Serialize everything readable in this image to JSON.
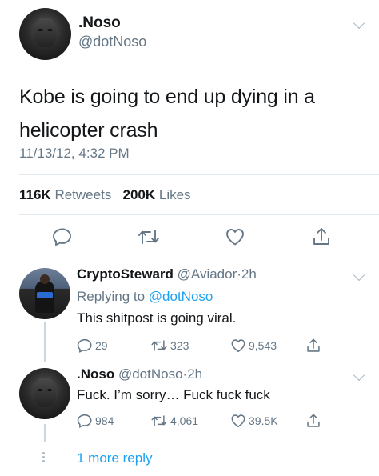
{
  "main_tweet": {
    "display_name": ".Noso",
    "handle": "@dotNoso",
    "text": "Kobe is going to end up dying in a helicopter crash",
    "timestamp": "11/13/12, 4:32 PM",
    "retweets_count": "116K",
    "retweets_label": "Retweets",
    "likes_count": "200K",
    "likes_label": "Likes",
    "icons": [
      "reply-icon",
      "retweet-icon",
      "like-icon",
      "share-icon"
    ]
  },
  "replies": [
    {
      "display_name": "CryptoSteward",
      "handle": "@Aviador",
      "separator": "·",
      "time": "2h",
      "replying_prefix": "Replying to",
      "replying_to": "@dotNoso",
      "text": "This shitpost is going viral.",
      "reply_count": "29",
      "retweet_count": "323",
      "like_count": "9,543"
    },
    {
      "display_name": ".Noso",
      "handle": "@dotNoso",
      "separator": "·",
      "time": "2h",
      "text": "Fuck. I’m sorry… Fuck fuck fuck",
      "reply_count": "984",
      "retweet_count": "4,061",
      "like_count": "39.5K"
    }
  ],
  "more_replies": "1 more reply",
  "colors": {
    "text": "#14171a",
    "secondary": "#657786",
    "link": "#1da1f2",
    "divider": "#e1e8ed"
  }
}
